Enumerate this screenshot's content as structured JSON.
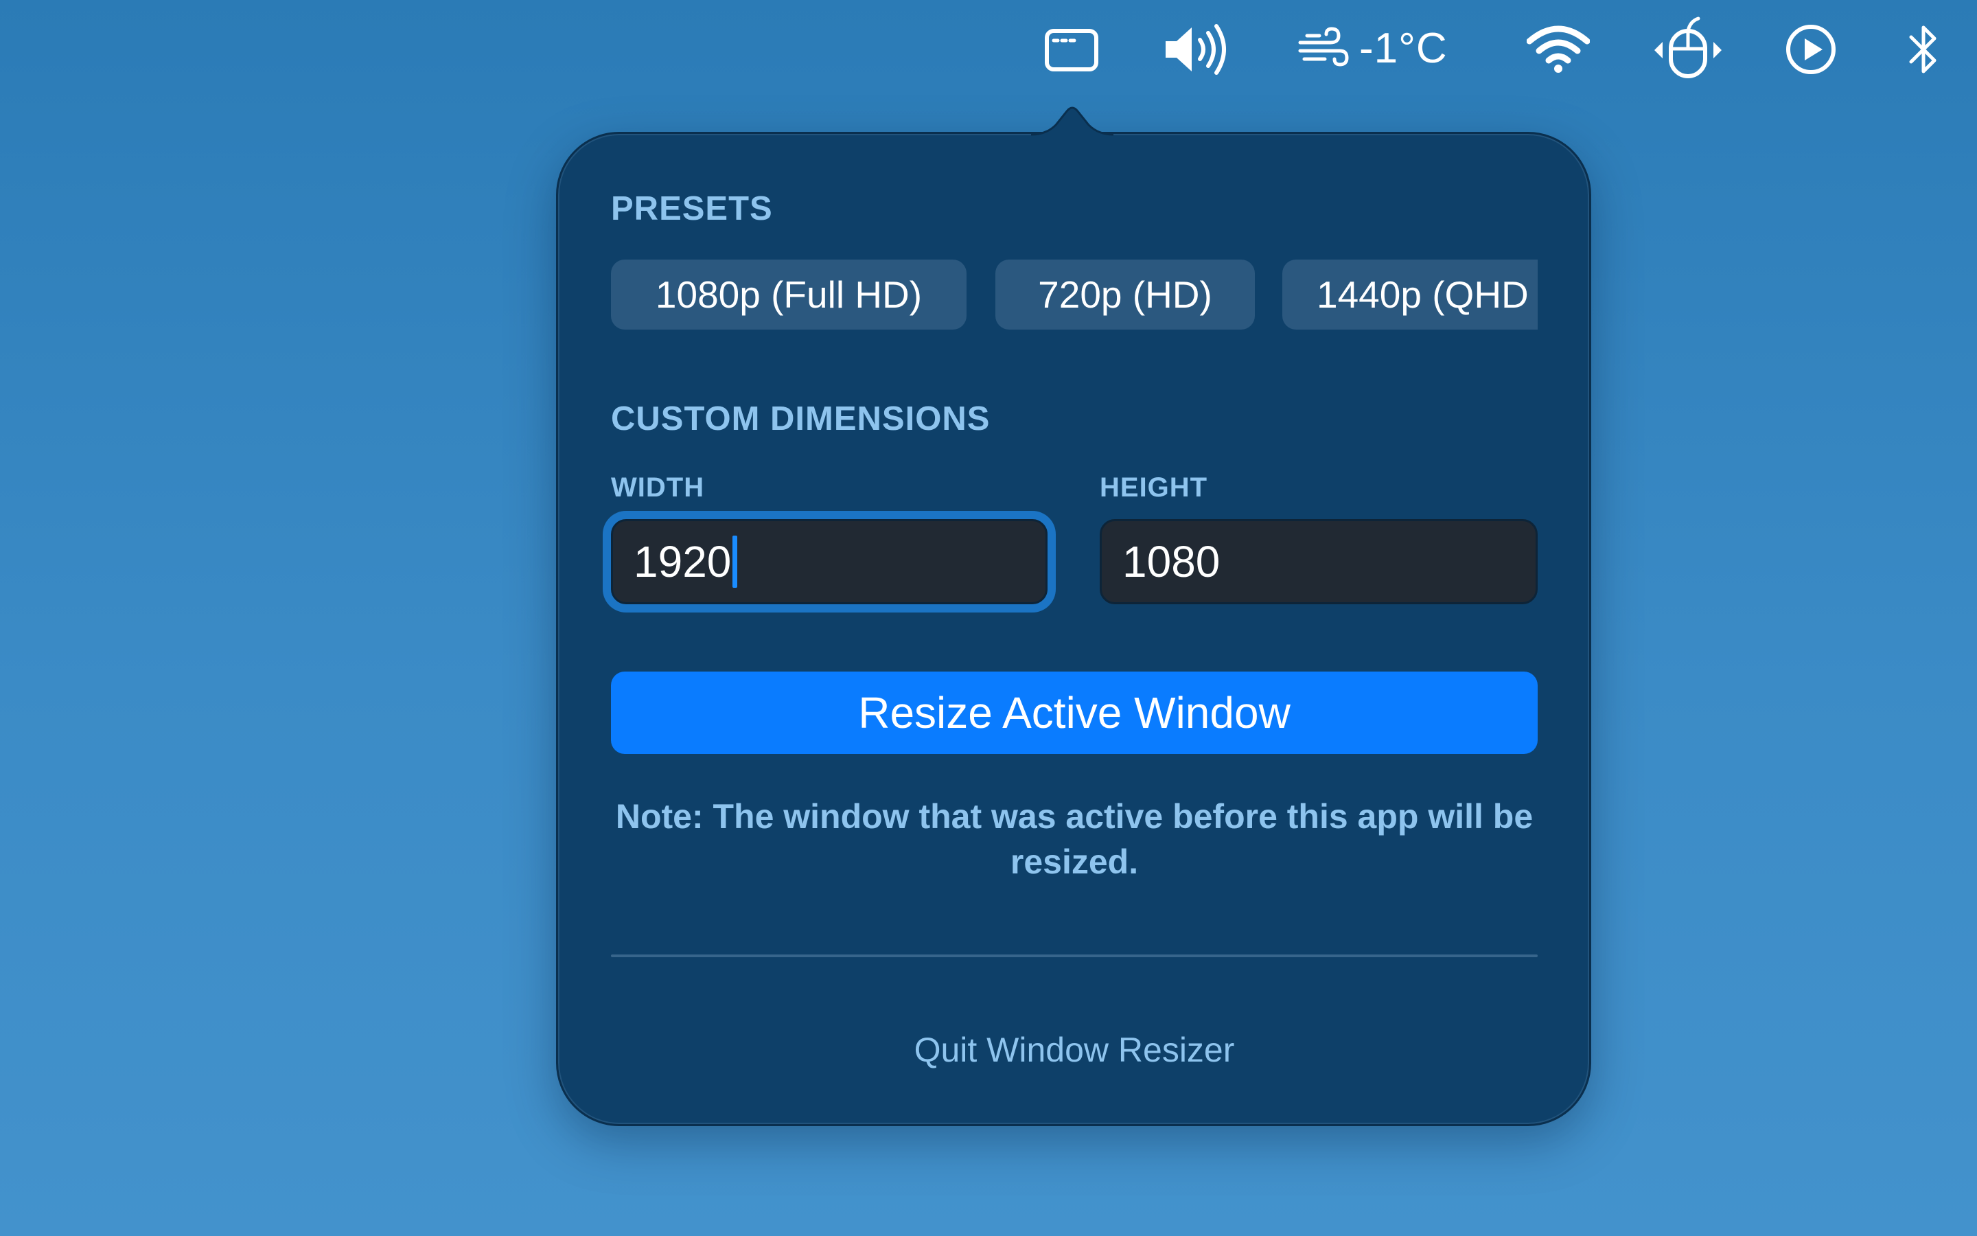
{
  "menubar": {
    "icons": [
      "window-resizer-icon",
      "volume-icon",
      "wind-icon",
      "wifi-icon",
      "mouse-icon",
      "play-circle-icon",
      "bluetooth-icon"
    ],
    "weather_temp": "-1°C"
  },
  "popover": {
    "presets_title": "PRESETS",
    "presets": [
      {
        "label": "1080p (Full HD)"
      },
      {
        "label": "720p (HD)"
      },
      {
        "label": "1440p (QHD"
      }
    ],
    "custom_title": "CUSTOM DIMENSIONS",
    "width_label": "WIDTH",
    "width_value": "1920",
    "height_label": "HEIGHT",
    "height_value": "1080",
    "resize_button": "Resize Active Window",
    "note": "Note: The window that was active before this app will be resized.",
    "quit": "Quit Window Resizer"
  },
  "colors": {
    "desktop": "#2f80bd",
    "popover_bg": "#0e4069",
    "accent": "#0a7cff",
    "label": "#8ec4ee",
    "chip": "#2b587f",
    "input_bg": "#212933"
  }
}
